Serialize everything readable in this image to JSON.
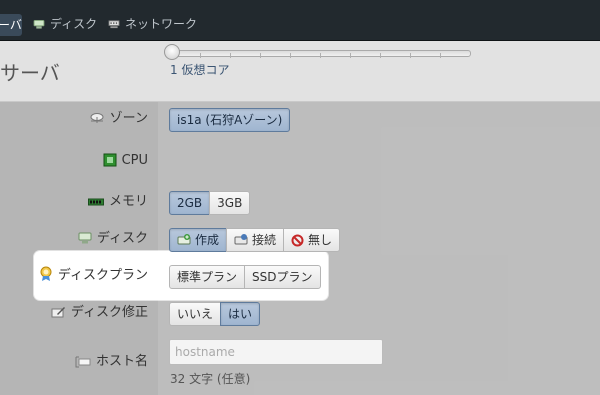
{
  "nav": {
    "active_tab_label": "ーバ",
    "tabs": [
      {
        "label": "ディスク",
        "icon": "disk-icon"
      },
      {
        "label": "ネットワーク",
        "icon": "network-icon"
      }
    ]
  },
  "header": {
    "title": "サーバ"
  },
  "form": {
    "zone": {
      "label": "ゾーン",
      "icon": "cloud-icon",
      "value": "is1a (石狩Aゾーン)"
    },
    "cpu": {
      "label": "CPU",
      "icon": "chip-icon",
      "value_text": "1 仮想コア",
      "slider_fraction": 0.0
    },
    "memory": {
      "label": "メモリ",
      "icon": "memory-icon",
      "options": [
        "2GB",
        "3GB"
      ],
      "selected": "2GB"
    },
    "disk": {
      "label": "ディスク",
      "icon": "disk-icon",
      "options": [
        "作成",
        "接続",
        "無し"
      ],
      "selected": "作成"
    },
    "disk_plan": {
      "label": "ディスクプラン",
      "icon": "award-icon",
      "options": [
        "標準プラン",
        "SSDプラン"
      ],
      "selected": ""
    },
    "disk_edit": {
      "label": "ディスク修正",
      "icon": "edit-icon",
      "options": [
        "いいえ",
        "はい"
      ],
      "selected": "はい"
    },
    "hostname": {
      "label": "ホスト名",
      "icon": "tag-icon",
      "placeholder": "hostname",
      "value": "",
      "hint": "32 文字 (任意)"
    }
  },
  "colors": {
    "nav_bg": "#22292e",
    "selected_bg": "#a9bcd4",
    "selected_border": "#5f7b9c",
    "link_text": "#3b5573"
  }
}
